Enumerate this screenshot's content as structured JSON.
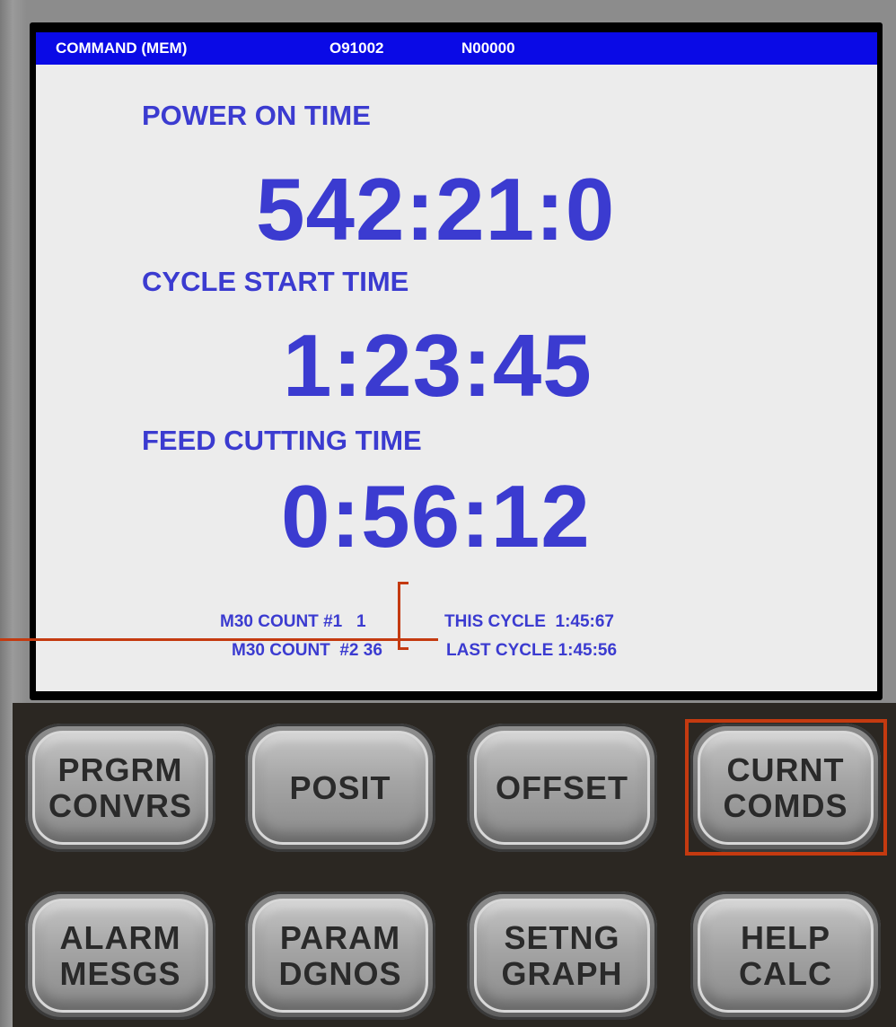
{
  "title_bar": {
    "mode": "COMMAND (MEM)",
    "program": "O91002",
    "sequence": "N00000",
    "color": "#0a0ae6"
  },
  "timers": {
    "power_on_label": "POWER ON TIME",
    "power_on_value": "542:21:0",
    "cycle_start_label": "CYCLE START TIME",
    "cycle_start_value": "1:23:45",
    "feed_cutting_label": "FEED CUTTING TIME",
    "feed_cutting_value": "0:56:12",
    "text_color": "#3b3bd0"
  },
  "counters": {
    "m30_count_1": "M30 COUNT #1   1",
    "m30_count_2": "M30 COUNT  #2 36",
    "this_cycle": "THIS CYCLE  1:45:67",
    "last_cycle": "LAST CYCLE 1:45:56"
  },
  "callout_color": "#c43a10",
  "keys": [
    {
      "line1": "PRGRM",
      "line2": "CONVRS",
      "icon": "none"
    },
    {
      "line1": "POSIT",
      "line2": "",
      "icon": "none"
    },
    {
      "line1": "OFFSET",
      "line2": "",
      "icon": "none"
    },
    {
      "line1": "CURNT",
      "line2": "COMDS",
      "icon": "none",
      "highlighted": true
    },
    {
      "line1": "ALARM",
      "line2": "MESGS",
      "icon": "none"
    },
    {
      "line1": "PARAM",
      "line2": "DGNOS",
      "icon": "none"
    },
    {
      "line1": "SETNG",
      "line2": "GRAPH",
      "icon": "none"
    },
    {
      "line1": "HELP",
      "line2": "CALC",
      "icon": "none"
    }
  ]
}
